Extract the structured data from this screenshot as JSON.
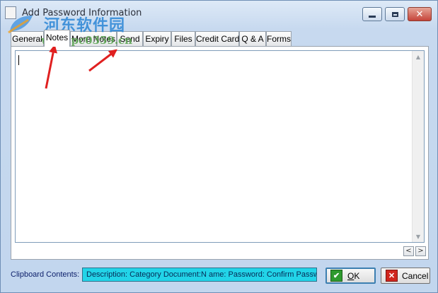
{
  "window": {
    "title": "Add Password Information",
    "icons": {
      "app": "document-icon",
      "minimize": "minimize-icon",
      "maximize": "maximize-icon",
      "close": "close-icon"
    }
  },
  "watermark": {
    "logo": "leaf-logo",
    "text": "河东软件园",
    "url": "www.pc0359.cn"
  },
  "tabs": [
    {
      "label": "General"
    },
    {
      "label": "Notes",
      "active": true
    },
    {
      "label": "More Notes"
    },
    {
      "label": "Send"
    },
    {
      "label": "Expiry"
    },
    {
      "label": "Files"
    },
    {
      "label": "Credit Card"
    },
    {
      "label": "Q & A"
    },
    {
      "label": "Forms"
    }
  ],
  "editor": {
    "value": ""
  },
  "nav": {
    "prev": "<",
    "next": ">"
  },
  "footer": {
    "clipboard_label": "Clipboard Contents:",
    "clipboard_value": "Description: Category Document:N ame: Password: Confirm Passwo",
    "clipboard_color": "#22d4e8",
    "ok_label_key": "O",
    "ok_label_rest": "K",
    "cancel_label": "Cancel"
  },
  "annotation_color": "#e02020"
}
